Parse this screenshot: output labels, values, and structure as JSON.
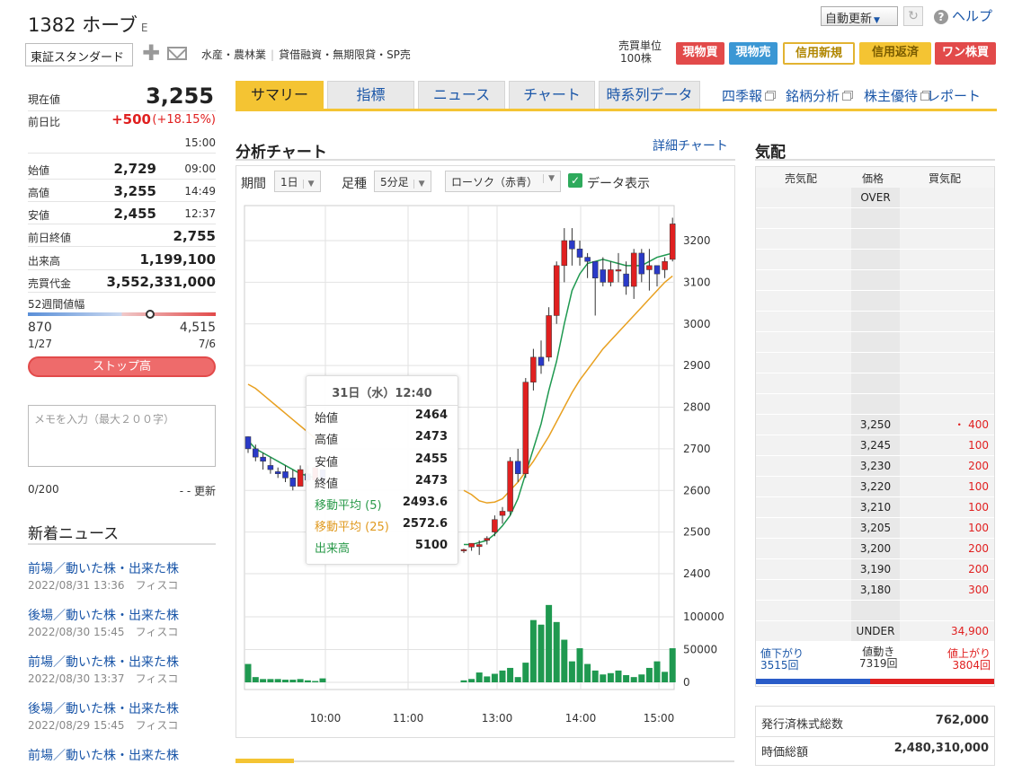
{
  "header": {
    "code": "1382",
    "name": "ホーブ",
    "market_badge": "E",
    "market": "東証スタンダード",
    "sector": "水産・農林業",
    "credit": "貸借融資・無期限貸・SP売",
    "auto_update": "自動更新",
    "help": "ヘルプ",
    "unit_label": "売買単位",
    "unit_value": "100株",
    "buttons": [
      "現物買",
      "現物売",
      "信用新規",
      "信用返済",
      "ワン株買"
    ]
  },
  "quote": {
    "price_label": "現在値",
    "price": "3,255",
    "change_label": "前日比",
    "change": "+500",
    "change_pct": "(+18.15%)",
    "time": "15:00",
    "rows": [
      {
        "label": "始値",
        "value": "2,729",
        "time": "09:00"
      },
      {
        "label": "高値",
        "value": "3,255",
        "time": "14:49"
      },
      {
        "label": "安値",
        "value": "2,455",
        "time": "12:37"
      }
    ],
    "prev_close_label": "前日終値",
    "prev_close": "2,755",
    "volume_label": "出来高",
    "volume": "1,199,100",
    "turnover_label": "売買代金",
    "turnover": "3,552,331,000",
    "range_label": "52週間値幅",
    "range_low": "870",
    "range_high": "4,515",
    "range_low_date": "1/27",
    "range_high_date": "7/6",
    "stop_label": "ストップ高",
    "range_pos": 0.65
  },
  "memo": {
    "placeholder": "メモを入力（最大２００字）",
    "count": "0/200",
    "updated": "- - 更新"
  },
  "news": {
    "title": "新着ニュース",
    "items": [
      {
        "title": "前場／動いた株・出来た株",
        "date": "2022/08/31 13:36",
        "source": "フィスコ"
      },
      {
        "title": "後場／動いた株・出来た株",
        "date": "2022/08/30 15:45",
        "source": "フィスコ"
      },
      {
        "title": "前場／動いた株・出来た株",
        "date": "2022/08/30 13:37",
        "source": "フィスコ"
      },
      {
        "title": "後場／動いた株・出来た株",
        "date": "2022/08/29 15:45",
        "source": "フィスコ"
      },
      {
        "title": "前場／動いた株・出来た株",
        "date": "",
        "source": ""
      }
    ]
  },
  "tabs": [
    "サマリー",
    "指標",
    "ニュース",
    "チャート",
    "時系列データ"
  ],
  "links": [
    "四季報",
    "銘柄分析",
    "株主優待",
    "レポート"
  ],
  "chart_panel": {
    "title": "分析チャート",
    "detail_link": "詳細チャート",
    "period_label": "期間",
    "period": "1日",
    "bar_label": "足種",
    "bar": "5分足",
    "style": "ローソク（赤青）",
    "show_data": "データ表示"
  },
  "tooltip": {
    "title": "31日（水）12:40",
    "rows": [
      {
        "label": "始値",
        "value": "2464"
      },
      {
        "label": "高値",
        "value": "2473"
      },
      {
        "label": "安値",
        "value": "2455"
      },
      {
        "label": "終値",
        "value": "2473"
      },
      {
        "label": "移動平均 (5)",
        "value": "2493.6"
      },
      {
        "label": "移動平均 (25)",
        "value": "2572.6"
      },
      {
        "label": "出来高",
        "value": "5100"
      }
    ]
  },
  "book": {
    "title": "気配",
    "col_sell": "売気配",
    "col_price": "価格",
    "col_buy": "買気配",
    "over": "OVER",
    "under": "UNDER",
    "under_qty": "34,900",
    "bids": [
      {
        "price": "3,250",
        "qty": "・ 400"
      },
      {
        "price": "3,245",
        "qty": "100"
      },
      {
        "price": "3,230",
        "qty": "200"
      },
      {
        "price": "3,220",
        "qty": "100"
      },
      {
        "price": "3,210",
        "qty": "100"
      },
      {
        "price": "3,205",
        "qty": "100"
      },
      {
        "price": "3,200",
        "qty": "200"
      },
      {
        "price": "3,190",
        "qty": "200"
      },
      {
        "price": "3,180",
        "qty": "300"
      }
    ],
    "down_label": "値下がり",
    "down": "3515回",
    "flat_label": "値動き",
    "flat": "7319回",
    "up_label": "値上がり",
    "up": "3804回"
  },
  "company": {
    "shares_label": "発行済株式総数",
    "shares": "762,000",
    "mcap_label": "時価総額",
    "mcap": "2,480,310,000"
  },
  "chart_data": {
    "type": "candlestick",
    "title": "",
    "x_ticks": [
      "10:00",
      "11:00",
      "13:00",
      "14:00",
      "15:00"
    ],
    "price_ticks": [
      2400,
      2500,
      2600,
      2700,
      2800,
      2900,
      3000,
      3100,
      3200
    ],
    "volume_ticks": [
      0,
      50000,
      100000
    ],
    "ylim": [
      2330,
      3265
    ],
    "candles": [
      [
        2729,
        2730,
        2690,
        2700
      ],
      [
        2700,
        2710,
        2670,
        2680
      ],
      [
        2680,
        2690,
        2650,
        2670
      ],
      [
        2660,
        2680,
        2640,
        2650
      ],
      [
        2645,
        2655,
        2630,
        2640
      ],
      [
        2645,
        2660,
        2620,
        2630
      ],
      [
        2630,
        2650,
        2600,
        2610
      ],
      [
        2610,
        2660,
        2620,
        2650
      ],
      [
        2640,
        2660,
        2620,
        2625
      ],
      [
        2625,
        2660,
        2605,
        2655
      ],
      [
        2650,
        2650,
        2610,
        2620
      ],
      [
        2455,
        2460,
        2450,
        2458
      ],
      [
        2464,
        2473,
        2455,
        2473
      ],
      [
        2465,
        2480,
        2445,
        2470
      ],
      [
        2480,
        2490,
        2470,
        2485
      ],
      [
        2500,
        2540,
        2490,
        2530
      ],
      [
        2540,
        2560,
        2520,
        2550
      ],
      [
        2550,
        2680,
        2540,
        2670
      ],
      [
        2670,
        2700,
        2620,
        2640
      ],
      [
        2640,
        2870,
        2630,
        2860
      ],
      [
        2860,
        2940,
        2840,
        2920
      ],
      [
        2920,
        2960,
        2880,
        2900
      ],
      [
        2920,
        3040,
        2910,
        3020
      ],
      [
        3020,
        3150,
        3000,
        3140
      ],
      [
        3140,
        3230,
        3100,
        3200
      ],
      [
        3200,
        3230,
        3140,
        3180
      ],
      [
        3180,
        3200,
        3140,
        3160
      ],
      [
        3160,
        3170,
        3110,
        3150
      ],
      [
        3150,
        3120,
        3020,
        3110
      ],
      [
        3130,
        3160,
        3090,
        3100
      ],
      [
        3100,
        3150,
        3090,
        3130
      ],
      [
        3130,
        3170,
        3100,
        3130
      ],
      [
        3120,
        3150,
        3070,
        3090
      ],
      [
        3090,
        3180,
        3060,
        3170
      ],
      [
        3170,
        3180,
        3100,
        3120
      ],
      [
        3130,
        3180,
        3080,
        3140
      ],
      [
        3140,
        3140,
        3090,
        3120
      ],
      [
        3130,
        3160,
        3110,
        3150
      ],
      [
        3155,
        3255,
        3150,
        3240
      ]
    ],
    "ma5": [
      2720,
      2700,
      2690,
      2680,
      2670,
      2660,
      2650,
      2640,
      2635,
      2630,
      2625,
      2470,
      2470,
      2475,
      2480,
      2495,
      2515,
      2540,
      2580,
      2640,
      2700,
      2760,
      2840,
      2910,
      3000,
      3080,
      3120,
      3145,
      3150,
      3155,
      3150,
      3145,
      3140,
      3140,
      3140,
      3150,
      3160,
      3165,
      3170
    ],
    "ma25": [
      2855,
      2845,
      2830,
      2815,
      2800,
      2785,
      2770,
      2755,
      2740,
      2725,
      2710,
      2600,
      2590,
      2575,
      2570,
      2572,
      2580,
      2600,
      2620,
      2645,
      2670,
      2700,
      2730,
      2765,
      2800,
      2835,
      2865,
      2890,
      2915,
      2940,
      2960,
      2980,
      3000,
      3020,
      3040,
      3060,
      3080,
      3100,
      3115
    ],
    "volumes": [
      28000,
      8000,
      5000,
      5000,
      5000,
      4000,
      4000,
      5000,
      3000,
      2000,
      6000,
      3000,
      5100,
      15000,
      9000,
      13000,
      18000,
      22000,
      8000,
      30000,
      95000,
      88000,
      118000,
      92000,
      65000,
      32000,
      52000,
      28000,
      18000,
      12000,
      14000,
      18000,
      11000,
      8000,
      12000,
      22000,
      32000,
      16000,
      52000
    ]
  }
}
